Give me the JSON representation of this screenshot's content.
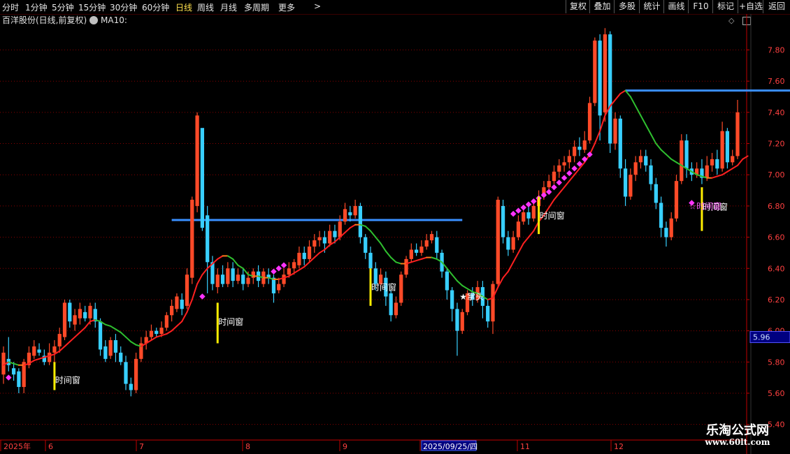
{
  "toolbar": {
    "periods": [
      "分时",
      "1分钟",
      "5分钟",
      "15分钟",
      "30分钟",
      "60分钟",
      "日线",
      "周线",
      "月线",
      "多周期",
      "更多"
    ],
    "active_period": "日线",
    "more_arrow": ">",
    "right_buttons": [
      "复权",
      "叠加",
      "多股",
      "统计",
      "画线",
      "F10",
      "标记",
      "+自选",
      "返回"
    ]
  },
  "header": {
    "stock_title": "百洋股份(日线,前复权)",
    "indicator_label": "MA10:"
  },
  "colors": {
    "up": "#ff4a28",
    "down": "#38cfff",
    "ma_up": "#ff2020",
    "ma_down": "#2fbf2f",
    "ma_flat": "#ff7a1a",
    "resistance": "#3a8fff",
    "grid": "#8a0000",
    "axis": "#c00000",
    "tick_text": "#ff4040",
    "time_window_bar": "#ffee00",
    "dots": "#ff33ff",
    "price_box": "#000080"
  },
  "chart_data": {
    "type": "candlestick",
    "ylim": [
      5.3,
      7.95
    ],
    "y_ticks": [
      "7.80",
      "7.60",
      "7.40",
      "7.20",
      "7.00",
      "6.80",
      "6.60",
      "6.40",
      "6.20",
      "6.00",
      "5.80",
      "5.60",
      "5.40"
    ],
    "current_price": "5.96",
    "x_labels": [
      "2025年",
      "6",
      "7",
      "8",
      "9",
      "2025/09/25/四",
      "11",
      "12"
    ],
    "candles": [
      [
        5.72,
        5.86,
        5.9,
        5.66
      ],
      [
        5.82,
        5.78,
        5.96,
        5.74
      ],
      [
        5.76,
        5.72,
        5.8,
        5.68
      ],
      [
        5.74,
        5.64,
        5.76,
        5.6
      ],
      [
        5.64,
        5.8,
        5.82,
        5.6
      ],
      [
        5.78,
        5.86,
        5.9,
        5.76
      ],
      [
        5.84,
        5.9,
        5.94,
        5.82
      ],
      [
        5.88,
        5.86,
        5.92,
        5.84
      ],
      [
        5.84,
        5.8,
        5.88,
        5.78
      ],
      [
        5.8,
        5.86,
        5.92,
        5.78
      ],
      [
        5.86,
        5.9,
        5.94,
        5.8
      ],
      [
        5.9,
        5.98,
        6.02,
        5.86
      ],
      [
        5.96,
        6.18,
        6.2,
        5.94
      ],
      [
        6.18,
        6.06,
        6.2,
        6.02
      ],
      [
        6.04,
        6.1,
        6.14,
        6.0
      ],
      [
        6.08,
        6.14,
        6.18,
        6.04
      ],
      [
        6.12,
        6.08,
        6.16,
        6.06
      ],
      [
        6.08,
        6.16,
        6.18,
        6.04
      ],
      [
        6.14,
        6.06,
        6.18,
        6.02
      ],
      [
        6.06,
        5.88,
        6.08,
        5.84
      ],
      [
        5.9,
        5.82,
        5.94,
        5.8
      ],
      [
        5.84,
        5.94,
        5.96,
        5.82
      ],
      [
        5.94,
        5.86,
        5.98,
        5.8
      ],
      [
        5.86,
        5.8,
        5.9,
        5.78
      ],
      [
        5.8,
        5.66,
        5.84,
        5.62
      ],
      [
        5.66,
        5.62,
        5.7,
        5.58
      ],
      [
        5.62,
        5.82,
        5.86,
        5.6
      ],
      [
        5.82,
        5.92,
        5.96,
        5.8
      ],
      [
        5.92,
        5.96,
        6.0,
        5.88
      ],
      [
        5.96,
        6.0,
        6.04,
        5.94
      ],
      [
        6.0,
        5.98,
        6.02,
        5.96
      ],
      [
        5.98,
        6.02,
        6.06,
        5.96
      ],
      [
        6.02,
        6.1,
        6.12,
        6.0
      ],
      [
        6.1,
        6.16,
        6.2,
        6.06
      ],
      [
        6.14,
        6.22,
        6.24,
        6.12
      ],
      [
        6.2,
        6.14,
        6.24,
        6.1
      ],
      [
        6.16,
        6.36,
        6.4,
        6.14
      ],
      [
        6.34,
        6.84,
        6.86,
        6.3
      ],
      [
        6.8,
        7.38,
        7.4,
        6.76
      ],
      [
        7.3,
        6.66,
        7.2,
        6.64
      ],
      [
        6.74,
        6.44,
        6.8,
        6.24
      ],
      [
        6.44,
        6.3,
        6.48,
        6.26
      ],
      [
        6.28,
        6.36,
        6.4,
        6.24
      ],
      [
        6.36,
        6.3,
        6.42,
        6.28
      ],
      [
        6.3,
        6.4,
        6.44,
        6.28
      ],
      [
        6.4,
        6.32,
        6.44,
        6.28
      ],
      [
        6.32,
        6.36,
        6.4,
        6.3
      ],
      [
        6.36,
        6.3,
        6.4,
        6.26
      ],
      [
        6.3,
        6.34,
        6.38,
        6.28
      ],
      [
        6.34,
        6.38,
        6.4,
        6.3
      ],
      [
        6.38,
        6.32,
        6.42,
        6.28
      ],
      [
        6.3,
        6.38,
        6.4,
        6.28
      ],
      [
        6.36,
        6.34,
        6.4,
        6.3
      ],
      [
        6.34,
        6.24,
        6.36,
        6.18
      ],
      [
        6.26,
        6.3,
        6.34,
        6.24
      ],
      [
        6.3,
        6.36,
        6.4,
        6.28
      ],
      [
        6.36,
        6.4,
        6.44,
        6.34
      ],
      [
        6.4,
        6.44,
        6.46,
        6.36
      ],
      [
        6.42,
        6.5,
        6.54,
        6.4
      ],
      [
        6.5,
        6.46,
        6.54,
        6.42
      ],
      [
        6.46,
        6.54,
        6.58,
        6.44
      ],
      [
        6.54,
        6.58,
        6.62,
        6.5
      ],
      [
        6.58,
        6.6,
        6.64,
        6.54
      ],
      [
        6.6,
        6.56,
        6.64,
        6.5
      ],
      [
        6.56,
        6.64,
        6.68,
        6.54
      ],
      [
        6.64,
        6.6,
        6.68,
        6.56
      ],
      [
        6.6,
        6.7,
        6.74,
        6.58
      ],
      [
        6.7,
        6.78,
        6.82,
        6.68
      ],
      [
        6.76,
        6.74,
        6.8,
        6.7
      ],
      [
        6.74,
        6.8,
        6.84,
        6.72
      ],
      [
        6.8,
        6.6,
        6.82,
        6.56
      ],
      [
        6.6,
        6.5,
        6.62,
        6.46
      ],
      [
        6.5,
        6.4,
        6.54,
        6.36
      ],
      [
        6.4,
        6.3,
        6.44,
        6.26
      ],
      [
        6.3,
        6.36,
        6.4,
        6.28
      ],
      [
        6.34,
        6.22,
        6.38,
        6.16
      ],
      [
        6.24,
        6.1,
        6.26,
        6.06
      ],
      [
        6.1,
        6.18,
        6.22,
        6.08
      ],
      [
        6.18,
        6.36,
        6.38,
        6.16
      ],
      [
        6.36,
        6.46,
        6.48,
        6.34
      ],
      [
        6.46,
        6.52,
        6.56,
        6.44
      ],
      [
        6.52,
        6.5,
        6.56,
        6.48
      ],
      [
        6.5,
        6.54,
        6.58,
        6.48
      ],
      [
        6.54,
        6.58,
        6.62,
        6.52
      ],
      [
        6.58,
        6.62,
        6.64,
        6.56
      ],
      [
        6.6,
        6.5,
        6.64,
        6.46
      ],
      [
        6.5,
        6.38,
        6.52,
        6.34
      ],
      [
        6.38,
        6.26,
        6.4,
        6.2
      ],
      [
        6.26,
        6.14,
        6.28,
        6.06
      ],
      [
        6.14,
        6.0,
        6.18,
        5.84
      ],
      [
        6.0,
        6.12,
        6.14,
        5.98
      ],
      [
        6.12,
        6.24,
        6.26,
        6.1
      ],
      [
        6.24,
        6.2,
        6.28,
        6.16
      ],
      [
        6.2,
        6.28,
        6.32,
        6.18
      ],
      [
        6.28,
        6.16,
        6.32,
        6.08
      ],
      [
        6.16,
        6.06,
        6.2,
        6.02
      ],
      [
        6.06,
        6.3,
        6.32,
        5.98
      ],
      [
        6.3,
        6.84,
        6.86,
        6.28
      ],
      [
        6.8,
        6.6,
        6.84,
        6.56
      ],
      [
        6.6,
        6.52,
        6.64,
        6.48
      ],
      [
        6.52,
        6.6,
        6.64,
        6.5
      ],
      [
        6.6,
        6.7,
        6.74,
        6.58
      ],
      [
        6.7,
        6.76,
        6.8,
        6.68
      ],
      [
        6.76,
        6.72,
        6.82,
        6.68
      ],
      [
        6.72,
        6.8,
        6.84,
        6.7
      ],
      [
        6.8,
        6.86,
        6.9,
        6.78
      ],
      [
        6.86,
        6.92,
        6.96,
        6.84
      ],
      [
        6.92,
        6.96,
        7.0,
        6.88
      ],
      [
        6.96,
        7.02,
        7.06,
        6.94
      ],
      [
        7.02,
        7.06,
        7.1,
        6.98
      ],
      [
        7.06,
        7.08,
        7.12,
        7.02
      ],
      [
        7.08,
        7.12,
        7.16,
        7.04
      ],
      [
        7.12,
        7.18,
        7.22,
        7.08
      ],
      [
        7.18,
        7.16,
        7.24,
        7.12
      ],
      [
        7.16,
        7.22,
        7.28,
        7.14
      ],
      [
        7.22,
        7.46,
        7.5,
        7.2
      ],
      [
        7.46,
        7.86,
        7.88,
        7.44
      ],
      [
        7.86,
        7.38,
        7.9,
        7.22
      ],
      [
        7.4,
        7.9,
        7.94,
        7.34
      ],
      [
        7.9,
        7.2,
        7.92,
        7.14
      ],
      [
        7.2,
        7.36,
        7.4,
        7.16
      ],
      [
        7.36,
        7.04,
        7.38,
        6.98
      ],
      [
        7.04,
        6.86,
        7.1,
        6.8
      ],
      [
        6.86,
        7.0,
        7.04,
        6.84
      ],
      [
        7.0,
        7.08,
        7.12,
        6.96
      ],
      [
        7.08,
        7.12,
        7.16,
        7.04
      ],
      [
        7.12,
        7.06,
        7.16,
        7.02
      ],
      [
        7.06,
        6.94,
        7.1,
        6.9
      ],
      [
        6.94,
        6.82,
        6.98,
        6.78
      ],
      [
        6.82,
        6.66,
        6.86,
        6.6
      ],
      [
        6.66,
        6.6,
        6.7,
        6.54
      ],
      [
        6.6,
        6.72,
        6.76,
        6.58
      ],
      [
        6.72,
        6.96,
        7.0,
        6.7
      ],
      [
        6.96,
        7.22,
        7.26,
        6.94
      ],
      [
        7.22,
        7.04,
        7.26,
        6.98
      ],
      [
        7.04,
        7.0,
        7.08,
        6.96
      ],
      [
        7.0,
        7.04,
        7.08,
        6.98
      ],
      [
        7.04,
        6.98,
        7.1,
        6.94
      ],
      [
        6.98,
        7.06,
        7.12,
        6.96
      ],
      [
        7.06,
        7.1,
        7.14,
        7.02
      ],
      [
        7.1,
        7.04,
        7.16,
        7.0
      ],
      [
        7.04,
        7.28,
        7.34,
        7.02
      ],
      [
        7.28,
        7.08,
        7.3,
        7.04
      ],
      [
        7.08,
        7.12,
        7.16,
        7.06
      ],
      [
        7.12,
        7.4,
        7.48,
        7.1
      ]
    ],
    "ma10": [
      5.78,
      5.8,
      5.79,
      5.78,
      5.78,
      5.79,
      5.81,
      5.82,
      5.83,
      5.84,
      5.85,
      5.87,
      5.9,
      5.93,
      5.96,
      5.99,
      6.02,
      6.06,
      6.07,
      6.06,
      6.04,
      6.03,
      6.01,
      5.99,
      5.96,
      5.93,
      5.91,
      5.9,
      5.92,
      5.94,
      5.96,
      5.97,
      5.98,
      6.0,
      6.03,
      6.06,
      6.12,
      6.2,
      6.3,
      6.36,
      6.4,
      6.43,
      6.46,
      6.48,
      6.48,
      6.46,
      6.42,
      6.4,
      6.36,
      6.35,
      6.35,
      6.34,
      6.34,
      6.33,
      6.33,
      6.34,
      6.35,
      6.37,
      6.39,
      6.41,
      6.44,
      6.47,
      6.5,
      6.52,
      6.55,
      6.57,
      6.6,
      6.63,
      6.66,
      6.68,
      6.68,
      6.67,
      6.64,
      6.6,
      6.56,
      6.51,
      6.47,
      6.44,
      6.43,
      6.43,
      6.44,
      6.45,
      6.46,
      6.47,
      6.47,
      6.46,
      6.44,
      6.4,
      6.36,
      6.32,
      6.29,
      6.27,
      6.25,
      6.24,
      6.22,
      6.2,
      6.21,
      6.28,
      6.34,
      6.38,
      6.44,
      6.5,
      6.56,
      6.6,
      6.64,
      6.7,
      6.74,
      6.79,
      6.84,
      6.88,
      6.92,
      6.96,
      7.0,
      7.04,
      7.08,
      7.13,
      7.2,
      7.28,
      7.38,
      7.44,
      7.48,
      7.52,
      7.54,
      7.5,
      7.44,
      7.38,
      7.32,
      7.26,
      7.2,
      7.16,
      7.13,
      7.1,
      7.08,
      7.06,
      7.04,
      7.02,
      7.0,
      6.99,
      6.98,
      6.98,
      6.99,
      7.0,
      7.02,
      7.04,
      7.06,
      7.1,
      7.12
    ],
    "resistance_lines": [
      {
        "from": 33,
        "to": 90,
        "value": 6.71
      },
      {
        "from": 122,
        "to": 156,
        "value": 7.54
      }
    ],
    "dots": [
      [
        1,
        5.7
      ],
      [
        53,
        6.38
      ],
      [
        54,
        6.4
      ],
      [
        55,
        6.42
      ],
      [
        39,
        6.22
      ],
      [
        100,
        6.75
      ],
      [
        101,
        6.77
      ],
      [
        102,
        6.79
      ],
      [
        103,
        6.81
      ],
      [
        104,
        6.83
      ],
      [
        105,
        6.85
      ],
      [
        106,
        6.87
      ],
      [
        107,
        6.89
      ],
      [
        108,
        6.92
      ],
      [
        109,
        6.95
      ],
      [
        110,
        6.98
      ],
      [
        111,
        7.01
      ],
      [
        112,
        7.04
      ],
      [
        113,
        7.07
      ],
      [
        114,
        7.1
      ],
      [
        115,
        7.13
      ],
      [
        135,
        6.82
      ]
    ],
    "time_window_markers": [
      {
        "index": 10,
        "low": 5.62,
        "high": 5.8,
        "label": "时间窗"
      },
      {
        "index": 42,
        "low": 5.92,
        "high": 6.18,
        "label": "时间窗"
      },
      {
        "index": 72,
        "low": 6.16,
        "high": 6.4,
        "label": "时间窗"
      },
      {
        "index": 105,
        "low": 6.62,
        "high": 6.86,
        "label": "时间窗"
      },
      {
        "index": 137,
        "low": 6.64,
        "high": 6.92,
        "label": "时间窗"
      }
    ],
    "annotations": [
      {
        "index": 90,
        "value": 6.2,
        "label": "★掌头",
        "color": "#ffffff"
      },
      {
        "index": 135,
        "value": 6.78,
        "label": "☆时间窗",
        "color": "#ff66ff"
      }
    ]
  },
  "watermark": {
    "title": "乐淘公式网",
    "url": "www.60lt.com"
  }
}
